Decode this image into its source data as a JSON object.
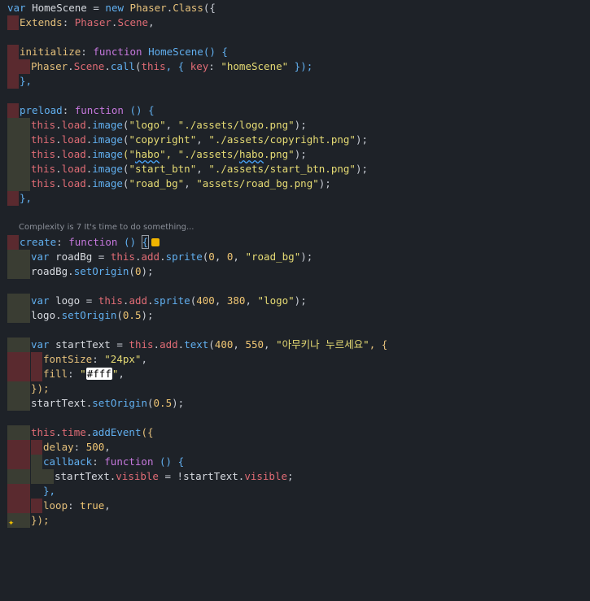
{
  "lines": {
    "l1": {
      "a": "var",
      "b": " HomeScene ",
      "c": "=",
      "d": " new ",
      "e": "Phaser",
      "f": ".",
      "g": "Class",
      "h": "({"
    },
    "l2": {
      "a": "Extends",
      "b": ": ",
      "c": "Phaser",
      "d": ".",
      "e": "Scene",
      "f": ","
    },
    "l4": {
      "a": "initialize",
      "b": ": ",
      "c": "function",
      "d": " HomeScene",
      "e": "() {"
    },
    "l5": {
      "a": "Phaser",
      "b": ".",
      "c": "Scene",
      "d": ".",
      "e": "call",
      "f": "(",
      "g": "this",
      "h": ", { ",
      "i": "key",
      "j": ": ",
      "k": "\"homeScene\"",
      "l": " });"
    },
    "l6": {
      "a": "},"
    },
    "l8": {
      "a": "preload",
      "b": ": ",
      "c": "function",
      "d": " () {"
    },
    "l9": {
      "a": "this",
      "b": ".",
      "c": "load",
      "d": ".",
      "e": "image",
      "f": "(",
      "g": "\"logo\"",
      "h": ", ",
      "i": "\"./assets/logo.png\"",
      "j": ");"
    },
    "l10": {
      "a": "this",
      "b": ".",
      "c": "load",
      "d": ".",
      "e": "image",
      "f": "(",
      "g": "\"copyright\"",
      "h": ", ",
      "i": "\"./assets/copyright.png\"",
      "j": ");"
    },
    "l11": {
      "a": "this",
      "b": ".",
      "c": "load",
      "d": ".",
      "e": "image",
      "f": "(\"",
      "g": "habo",
      "h": "\", ",
      "i": "\"./assets/",
      "j": "habo",
      "k": ".png\"",
      "l": ");"
    },
    "l12": {
      "a": "this",
      "b": ".",
      "c": "load",
      "d": ".",
      "e": "image",
      "f": "(",
      "g": "\"start_btn\"",
      "h": ", ",
      "i": "\"./assets/start_btn.png\"",
      "j": ");"
    },
    "l13": {
      "a": "this",
      "b": ".",
      "c": "load",
      "d": ".",
      "e": "image",
      "f": "(",
      "g": "\"road_bg\"",
      "h": ", ",
      "i": "\"assets/road_bg.png\"",
      "j": ");"
    },
    "l14": {
      "a": "},"
    },
    "hint": "Complexity is 7 It's time to do something...",
    "l16": {
      "a": "create",
      "b": ": ",
      "c": "function",
      "d": " () ",
      "e": "{"
    },
    "l17": {
      "a": "var",
      "b": " roadBg ",
      "c": "=",
      "d": " this",
      "e": ".",
      "f": "add",
      "g": ".",
      "h": "sprite",
      "i": "(",
      "j": "0",
      "k": ", ",
      "l": "0",
      "m": ", ",
      "n": "\"road_bg\"",
      "o": ");"
    },
    "l18": {
      "a": "roadBg",
      "b": ".",
      "c": "setOrigin",
      "d": "(",
      "e": "0",
      "f": ");"
    },
    "l20": {
      "a": "var",
      "b": " logo ",
      "c": "=",
      "d": " this",
      "e": ".",
      "f": "add",
      "g": ".",
      "h": "sprite",
      "i": "(",
      "j": "400",
      "k": ", ",
      "l": "380",
      "m": ", ",
      "n": "\"logo\"",
      "o": ");"
    },
    "l21": {
      "a": "logo",
      "b": ".",
      "c": "setOrigin",
      "d": "(",
      "e": "0.5",
      "f": ");"
    },
    "l23": {
      "a": "var",
      "b": " startText ",
      "c": "=",
      "d": " this",
      "e": ".",
      "f": "add",
      "g": ".",
      "h": "text",
      "i": "(",
      "j": "400",
      "k": ", ",
      "l": "550",
      "m": ", ",
      "n": "\"아무키나 누르세요\"",
      "o": ", {"
    },
    "l24": {
      "a": "fontSize",
      "b": ": ",
      "c": "\"24px\"",
      "d": ","
    },
    "l25": {
      "a": "fill",
      "b": ": ",
      "c": "\"",
      "d": "#fff",
      "e": "\"",
      "f": ","
    },
    "l26": {
      "a": "});"
    },
    "l27": {
      "a": "startText",
      "b": ".",
      "c": "setOrigin",
      "d": "(",
      "e": "0.5",
      "f": ");"
    },
    "l29": {
      "a": "this",
      "b": ".",
      "c": "time",
      "d": ".",
      "e": "addEvent",
      "f": "({"
    },
    "l30": {
      "a": "delay",
      "b": ": ",
      "c": "500",
      "d": ","
    },
    "l31": {
      "a": "callback",
      "b": ": ",
      "c": "function",
      "d": " () {"
    },
    "l32": {
      "a": "startText",
      "b": ".",
      "c": "visible",
      "d": " = !",
      "e": "startText",
      "f": ".",
      "g": "visible",
      "h": ";"
    },
    "l33": {
      "a": "},"
    },
    "l34": {
      "a": "loop",
      "b": ": ",
      "c": "true",
      "d": ","
    },
    "l35": {
      "a": "});"
    }
  },
  "colors": {
    "background": "#1e2228",
    "keyword": "#c678dd",
    "function": "#61afef",
    "type": "#e5c07b",
    "string": "#e6db74",
    "error_gutter": "#5a2a2f"
  },
  "icons": {
    "sparkle": "sparkle-icon",
    "bulb": "lightbulb-square-icon"
  }
}
